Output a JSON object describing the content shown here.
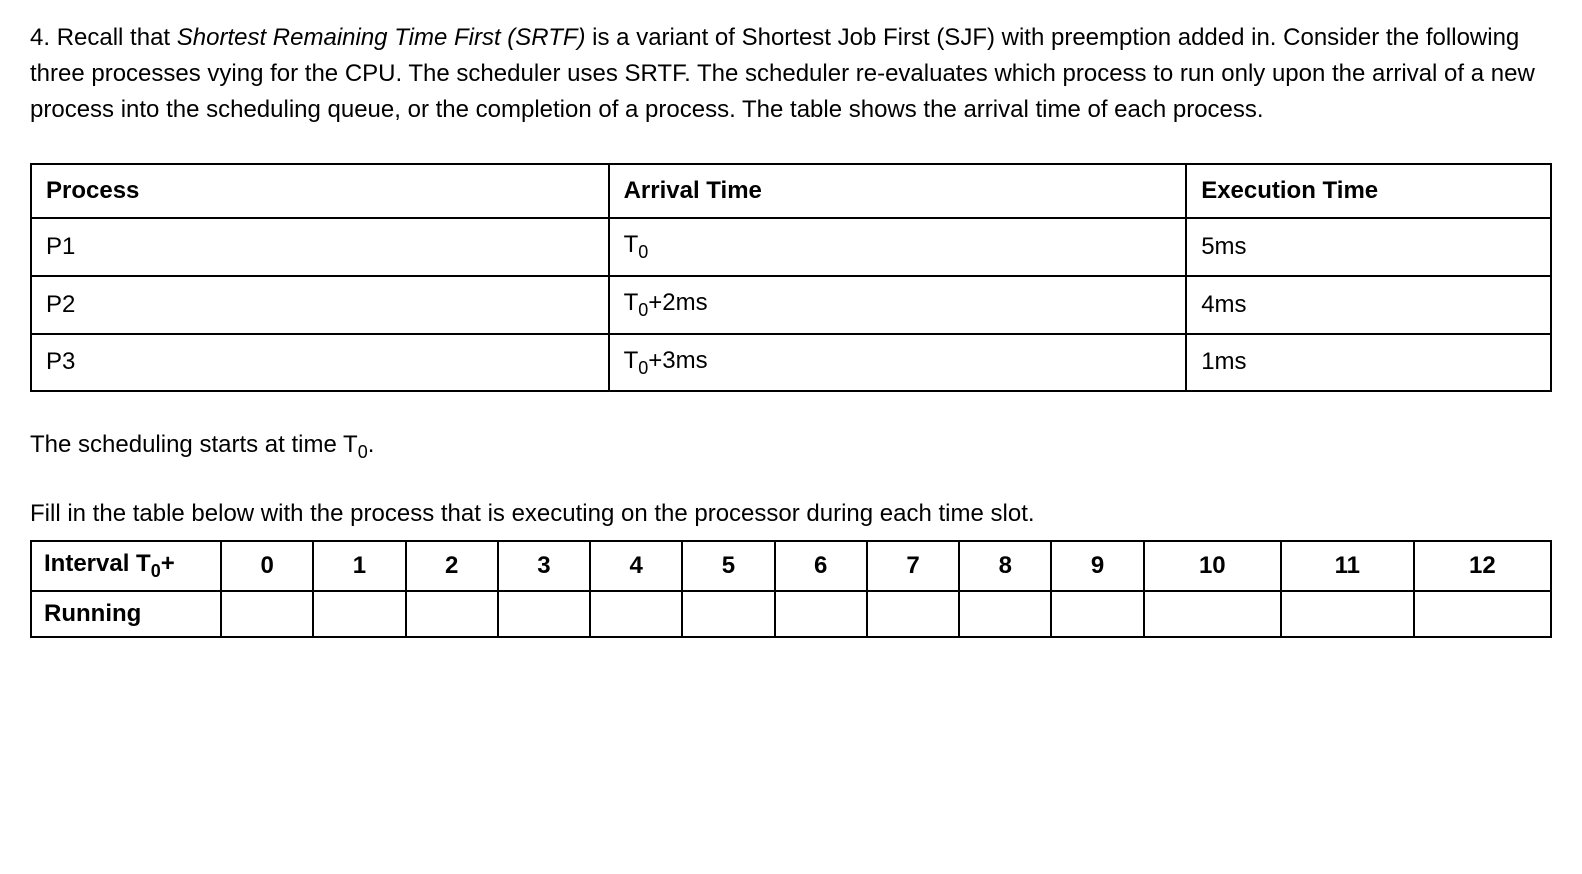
{
  "question": {
    "number": "4. ",
    "part1a": "Recall that ",
    "italic": "Shortest Remaining Time First (SRTF)",
    "part1b": " is a variant of Shortest Job First (SJF) with preemption added in. Consider the following three processes vying for the CPU. The scheduler uses SRTF. The scheduler re-evaluates which process to run only upon the arrival of a new process into the scheduling queue, or the completion of a process. The table shows the arrival time of each process."
  },
  "process_table": {
    "headers": {
      "h1": "Process",
      "h2": "Arrival Time",
      "h3": "Execution Time"
    },
    "rows": [
      {
        "process": "P1",
        "arrival_prefix": "T",
        "arrival_sub": "0",
        "arrival_suffix": "",
        "exec": "5ms"
      },
      {
        "process": "P2",
        "arrival_prefix": "T",
        "arrival_sub": "0",
        "arrival_suffix": "+2ms",
        "exec": "4ms"
      },
      {
        "process": "P3",
        "arrival_prefix": "T",
        "arrival_sub": "0",
        "arrival_suffix": "+3ms",
        "exec": "1ms"
      }
    ]
  },
  "mid_text": {
    "prefix": "The scheduling starts at time T",
    "sub": "0",
    "suffix": "."
  },
  "fill_text": "Fill in the table below with the process that is executing on the processor during each time slot.",
  "schedule_table": {
    "row1_label_prefix": "Interval T",
    "row1_label_sub": "0",
    "row1_label_suffix": "+",
    "intervals": [
      "0",
      "1",
      "2",
      "3",
      "4",
      "5",
      "6",
      "7",
      "8",
      "9",
      "10",
      "11",
      "12"
    ],
    "row2_label": "Running",
    "running": [
      "",
      "",
      "",
      "",
      "",
      "",
      "",
      "",
      "",
      "",
      "",
      "",
      ""
    ]
  },
  "chart_data": {
    "type": "table",
    "tables": [
      {
        "name": "process_arrival_exec",
        "columns": [
          "Process",
          "Arrival Time",
          "Execution Time"
        ],
        "rows": [
          [
            "P1",
            "T0",
            "5ms"
          ],
          [
            "P2",
            "T0+2ms",
            "4ms"
          ],
          [
            "P3",
            "T0+3ms",
            "1ms"
          ]
        ]
      },
      {
        "name": "schedule_fill_in",
        "columns": [
          "Interval T0+",
          "0",
          "1",
          "2",
          "3",
          "4",
          "5",
          "6",
          "7",
          "8",
          "9",
          "10",
          "11",
          "12"
        ],
        "rows": [
          [
            "Running",
            "",
            "",
            "",
            "",
            "",
            "",
            "",
            "",
            "",
            "",
            "",
            "",
            ""
          ]
        ]
      }
    ]
  }
}
